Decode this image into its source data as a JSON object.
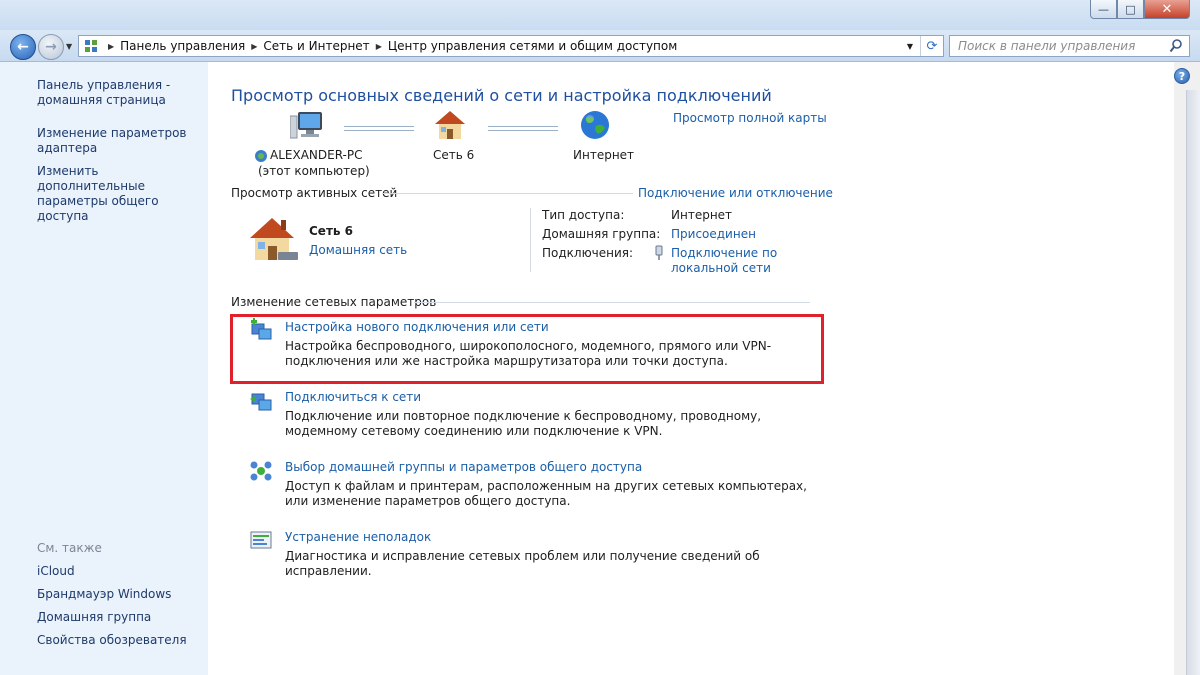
{
  "window": {
    "min_glyph": "—",
    "max_glyph": "□",
    "close_glyph": "✕"
  },
  "nav": {
    "breadcrumbs": [
      "Панель управления",
      "Сеть и Интернет",
      "Центр управления сетями и общим доступом"
    ],
    "search_placeholder": "Поиск в панели управления"
  },
  "sidebar": {
    "links": [
      {
        "label": "Панель управления - домашняя страница"
      },
      {
        "label": "Изменение параметров адаптера"
      },
      {
        "label": "Изменить дополнительные параметры общего доступа"
      }
    ],
    "see_also_header": "См. также",
    "see_also": [
      "iCloud",
      "Брандмауэр Windows",
      "Домашняя группа",
      "Свойства обозревателя"
    ]
  },
  "main": {
    "title": "Просмотр основных сведений о сети и настройка подключений",
    "full_map_link": "Просмотр полной карты",
    "map": {
      "computer_name": "ALEXANDER-PC",
      "computer_sub": "(этот компьютер)",
      "network_name": "Сеть  6",
      "internet": "Интернет"
    },
    "active_header": "Просмотр активных сетей",
    "connect_disconnect": "Подключение или отключение",
    "active_network": {
      "name": "Сеть  6",
      "type_link": "Домашняя сеть",
      "access_label": "Тип доступа:",
      "access_value": "Интернет",
      "homegroup_label": "Домашняя группа:",
      "homegroup_value": "Присоединен",
      "connections_label": "Подключения:",
      "connections_value": "Подключение по локальной сети"
    },
    "change_header": "Изменение сетевых параметров",
    "tasks": [
      {
        "title": "Настройка нового подключения или сети",
        "desc": "Настройка беспроводного, широкополосного, модемного, прямого или VPN-подключения или же настройка маршрутизатора или точки доступа."
      },
      {
        "title": "Подключиться к сети",
        "desc": "Подключение или повторное подключение к беспроводному, проводному, модемному сетевому соединению или подключение к VPN."
      },
      {
        "title": "Выбор домашней группы и параметров общего доступа",
        "desc": "Доступ к файлам и принтерам, расположенным на других сетевых компьютерах, или изменение параметров общего доступа."
      },
      {
        "title": "Устранение неполадок",
        "desc": "Диагностика и исправление сетевых проблем или получение сведений об исправлении."
      }
    ]
  },
  "help_glyph": "?",
  "colors": {
    "link": "#1a5ea8",
    "title": "#1e4fa0",
    "highlight": "#e0202a",
    "sidebar_bg": "#eaf2fb"
  }
}
